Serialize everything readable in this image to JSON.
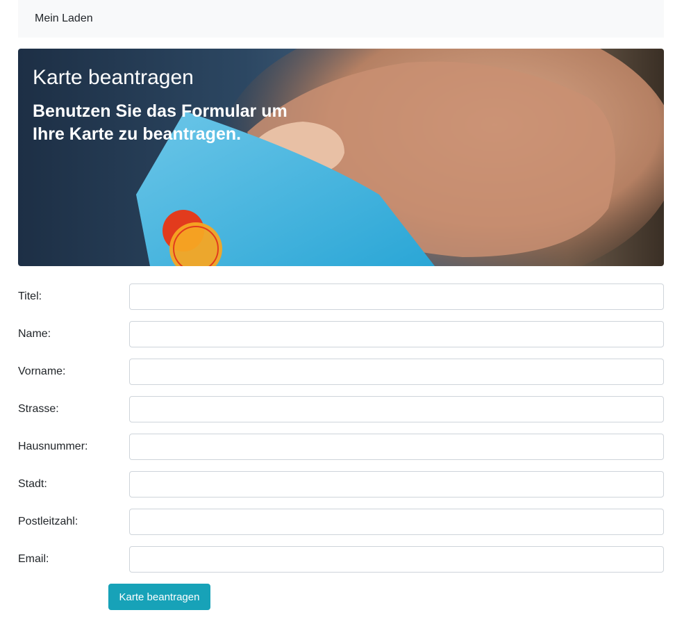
{
  "navbar": {
    "brand": "Mein Laden"
  },
  "hero": {
    "title": "Karte beantragen",
    "subtitle": "Benutzen Sie das Formular um Ihre Karte zu beantragen."
  },
  "form": {
    "fields": [
      {
        "label": "Titel:",
        "value": ""
      },
      {
        "label": "Name:",
        "value": ""
      },
      {
        "label": "Vorname:",
        "value": ""
      },
      {
        "label": "Strasse:",
        "value": ""
      },
      {
        "label": "Hausnummer:",
        "value": ""
      },
      {
        "label": "Stadt:",
        "value": ""
      },
      {
        "label": "Postleitzahl:",
        "value": ""
      },
      {
        "label": "Email:",
        "value": ""
      }
    ],
    "submit_label": "Karte beantragen"
  },
  "colors": {
    "accent": "#17a2b8",
    "navbar_bg": "#f8f9fa",
    "input_border": "#ced4da"
  }
}
